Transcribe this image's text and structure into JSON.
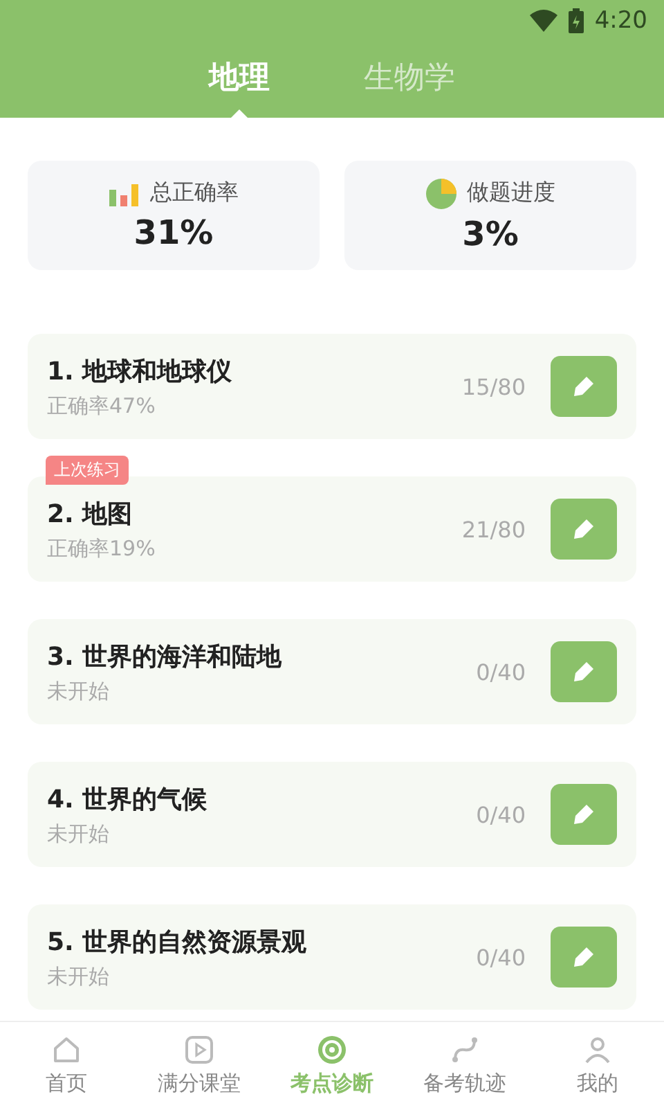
{
  "status_bar": {
    "time": "4:20"
  },
  "tabs": [
    {
      "label": "地理",
      "selected": true
    },
    {
      "label": "生物学",
      "selected": false
    }
  ],
  "stats": [
    {
      "kind": "accuracy",
      "label": "总正确率",
      "value": "31%"
    },
    {
      "kind": "progress",
      "label": "做题进度",
      "value": "3%"
    }
  ],
  "chapters": [
    {
      "title": "1. 地球和地球仪",
      "subtitle": "正确率47%",
      "count": "15/80"
    },
    {
      "title": "2. 地图",
      "subtitle": "正确率19%",
      "count": "21/80",
      "badge": "上次练习"
    },
    {
      "title": "3. 世界的海洋和陆地",
      "subtitle": "未开始",
      "count": "0/40"
    },
    {
      "title": "4. 世界的气候",
      "subtitle": "未开始",
      "count": "0/40"
    },
    {
      "title": "5. 世界的自然资源景观",
      "subtitle": "未开始",
      "count": "0/40"
    }
  ],
  "bottom_nav": [
    {
      "label": "首页",
      "kind": "home",
      "selected": false
    },
    {
      "label": "满分课堂",
      "kind": "play",
      "selected": false
    },
    {
      "label": "考点诊断",
      "kind": "target",
      "selected": true
    },
    {
      "label": "备考轨迹",
      "kind": "track",
      "selected": false
    },
    {
      "label": "我的",
      "kind": "person",
      "selected": false
    }
  ]
}
